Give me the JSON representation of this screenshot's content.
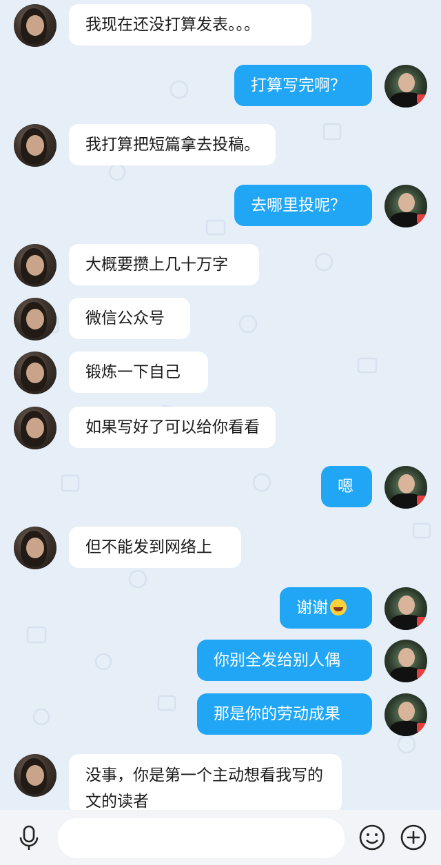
{
  "messages": [
    {
      "side": "in",
      "text": "我现在还没打算发表。。。"
    },
    {
      "side": "out",
      "text": "打算写完啊？"
    },
    {
      "side": "in",
      "text": "我打算把短篇拿去投稿。"
    },
    {
      "side": "out",
      "text": "去哪里投呢？"
    },
    {
      "side": "in",
      "text": "大概要攒上几十万字"
    },
    {
      "side": "in",
      "text": "微信公众号"
    },
    {
      "side": "in",
      "text": "锻炼一下自己"
    },
    {
      "side": "in",
      "text": "如果写好了可以给你看看"
    },
    {
      "side": "out",
      "text": "嗯"
    },
    {
      "side": "in",
      "text": "但不能发到网络上"
    },
    {
      "side": "out",
      "text": "谢谢",
      "emoji": "laughing-tears-emoji"
    },
    {
      "side": "out",
      "text": "你别全发给别人偶"
    },
    {
      "side": "out",
      "text": "那是你的劳动成果"
    },
    {
      "side": "in",
      "text": "没事，你是第一个主动想看我写的文的读者"
    }
  ],
  "colors": {
    "outgoing_bubble": "#20a6f5",
    "incoming_bubble": "#ffffff",
    "background": "#e6eef7"
  },
  "input": {
    "placeholder": ""
  },
  "icons": {
    "voice": "microphone-icon",
    "emoji": "smiley-icon",
    "more": "plus-circle-icon"
  }
}
